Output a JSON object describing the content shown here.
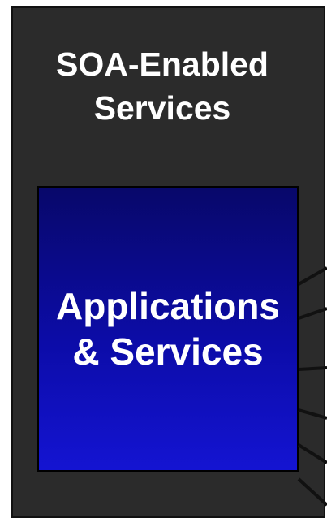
{
  "panel": {
    "title_line1": "SOA-Enabled",
    "title_line2": "Services"
  },
  "box": {
    "label_line1": "Applications",
    "label_line2": "& Services"
  },
  "colors": {
    "panel_bg": "#2b2b2b",
    "box_top": "#08086a",
    "box_bottom": "#1414d2",
    "text": "#ffffff",
    "connector": "#111111"
  }
}
